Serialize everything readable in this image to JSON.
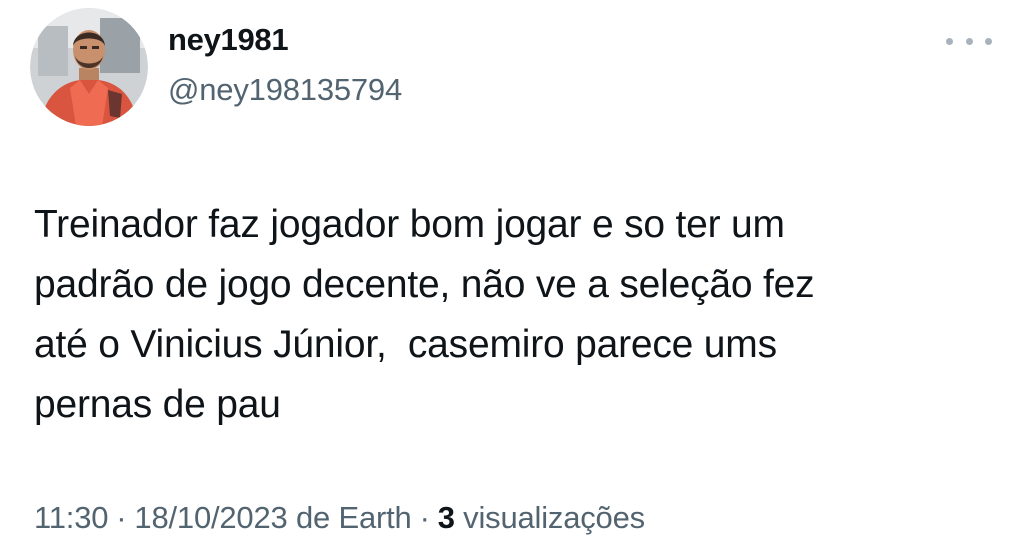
{
  "user": {
    "display_name": "ney1981",
    "handle": "@ney198135794",
    "avatar_icon": "profile-photo-avatar"
  },
  "menu": {
    "icon": "more-options-icon"
  },
  "tweet": {
    "lines": [
      "Treinador faz jogador bom jogar e so ter um",
      "padrão de jogo decente, não ve a seleção fez",
      "até o Vinicius Júnior,  casemiro parece ums",
      "pernas de pau"
    ]
  },
  "meta": {
    "time": "11:30",
    "separator": "·",
    "date": "18/10/2023 de Earth",
    "views_count": "3",
    "views_label": "visualizações"
  },
  "colors": {
    "text": "#0f1419",
    "secondary": "#536471",
    "background": "#ffffff"
  }
}
